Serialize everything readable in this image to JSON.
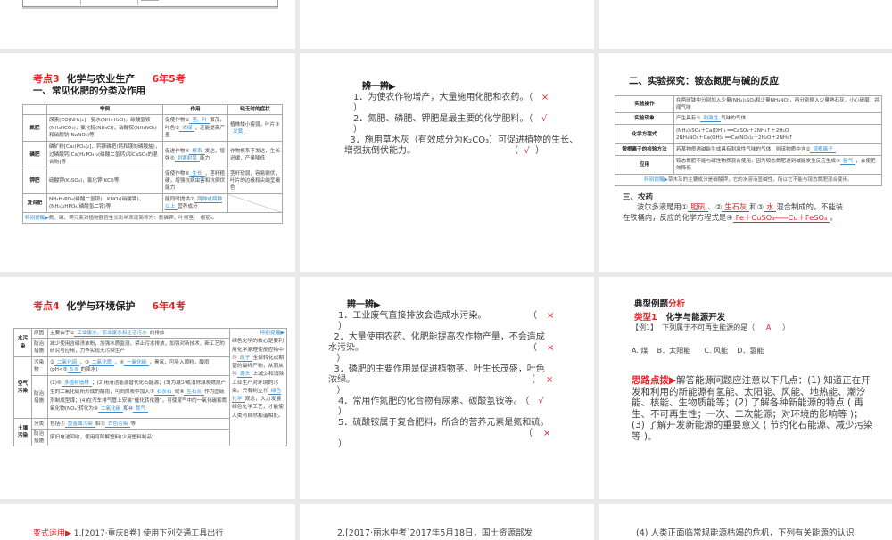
{
  "slide_top_left": {},
  "s3": {
    "title_prefix": "考点3",
    "title_main": "化学与农业生产",
    "title_freq": "6年5考",
    "subtitle": "一、常见化肥的分类及作用",
    "headers": [
      "",
      "举例",
      "作用",
      "缺乏时的症状"
    ],
    "rows": [
      {
        "type": "氮肥",
        "example": "尿素[CO(NH₂)₂]，氨水(NH₃·H₂O)，碳酸氢铵(NH₄HCO₃)，氯化铵(NH₄Cl)，硝酸铵(NH₄NO₃)和硝酸钠(NaNO₃)等",
        "effect_pre": "促使作物①",
        "fill1": "茎、叶",
        "effect_mid": "繁茂，叶色②",
        "fill2": "浓绿",
        "effect_post": "，还能提高产量",
        "symptom_pre": "植株矮小瘦弱，叶片③",
        "symptom_fill": "发黄"
      },
      {
        "type": "磷肥",
        "example": "磷矿粉[Ca₃(PO₄)₂]，钙镁磷肥(钙和镁的磷酸盐)，过磷酸钙[Ca(H₂PO₄)₂(磷酸二氢钙)和CaSO₄的混合物]等",
        "effect_pre": "促进作物④",
        "fill1": "根系",
        "effect_mid": "发达，增强⑤",
        "fill2": "耐寒耐旱",
        "effect_post": "能力",
        "symptom": "作物根系不发达，生长迟缓，产量降低"
      },
      {
        "type": "钾肥",
        "example": "硫酸钾(K₂SO₄)，氯化钾(KCl)等",
        "effect_pre": "促使作物⑥",
        "fill1": "生长",
        "effect_post": "，茎秆粗硬，增强抗病虫害和抗倒伏能力",
        "symptom": "茎秆软弱，容易倒伏，叶片的边缘和尖端呈褐色"
      },
      {
        "type": "复合肥",
        "example": "NH₄H₂PO₄(磷酸二氢铵)，KNO₃(硝酸钾)，(NH₄)₂HPO₄(磷酸氢二铵)等",
        "effect_pre": "能同时提供⑦",
        "fill1": "两种或两种以上",
        "effect_post": "营养成分"
      }
    ],
    "tip_label": "特别提醒▶",
    "tip": "氮、磷、钾元素对植物器官生长影响表现简称为：氮磷钾，叶根茎(一根筋)。"
  },
  "b1": {
    "heading": "辨一辨▶",
    "items": [
      {
        "text": "1．为使农作物增产，大量施用化肥和农药。（",
        "mark": "×",
        "close": "）"
      },
      {
        "text": "2．氮肥、磷肥、钾肥是最主要的化学肥料。（",
        "mark": "√",
        "close": "）"
      },
      {
        "text": "3．施用草木灰（有效成分为K₂CO₃）可促进植物的生长、",
        "text2": "增强抗倒伏能力。",
        "open": "（",
        "mark": "√",
        "close": "）"
      }
    ]
  },
  "exp": {
    "title": "二、实验探究：铵态氮肥与碱的反应",
    "rows": [
      {
        "label": "实验操作",
        "text": "在两研钵中分别加入少量(NH₄)₂SO₄和少量NH₄NO₃，再分别倒入少量熟石灰，小心研磨，并闻气味"
      },
      {
        "label": "实验现象",
        "pre": "产生具有①",
        "fill": "刺激性",
        "post": "气味的气体"
      },
      {
        "label": "化学方程式",
        "eq1": "(NH₄)₂SO₄＋Ca(OH)₂ ══CaSO₄＋2NH₃↑＋2H₂O",
        "eq2": "2NH₄NO₃＋Ca(OH)₂ ══Ca(NO₃)₂＋2H₂O＋2NH₃↑"
      },
      {
        "label": "铵根离子的检验方法",
        "pre": "若某物质遇碱能生成具有刺激性气味的气体，则该物质中含②",
        "fill": "铵根离子"
      },
      {
        "label": "应用",
        "pre": "铵态氮肥不能与碱性物质混合使用，因为铵态氮肥遇到碱能发生反应生成③",
        "fill": "氨气",
        "post": "，会使肥效降低"
      }
    ],
    "tip_label": "特别提醒▶",
    "tip": "草木灰的主要成分是碳酸钾，它的水溶液显碱性，所以它不能与铵态氮肥混合使用。",
    "pest_title": "三、农药",
    "pest_pre": "波尔多液是用①",
    "pest_f1": "胆矾",
    "pest_m1": "、②",
    "pest_f2": "生石灰",
    "pest_m2": "和③",
    "pest_f3": "水",
    "pest_m3": "混合制成的，不能装",
    "pest_l2": "在铁桶内，反应的化学方程式是④",
    "pest_eq": "Fe＋CuSO₄═══Cu＋FeSO₄",
    "pest_end": "。"
  },
  "s4": {
    "title_prefix": "考点4",
    "title_main": "化学与环境保护",
    "title_freq": "6年4考",
    "water": "水污染",
    "air": "空气污染",
    "soil": "土壤污染",
    "cause": "原因",
    "prevent": "防治措施",
    "pollutant": "污染物",
    "category": "分类",
    "water_cause_pre": "主要由于①",
    "water_cause_fill": "工业废水、农业废水和生活污水",
    "water_cause_post": "的排放",
    "water_prevent": "减少使用含磷洗衣粉，加强水质监测，禁止污水排放，加强对新技术、新工艺的研究与应用，力争实现无污染生产",
    "air_p": [
      "②",
      "二氧化硫",
      "，③",
      "二氧化氮",
      "，④",
      "一氧化碳",
      "，臭氧，可吸入颗粒，酸雨(pH<⑤",
      "5.6",
      "的降水)"
    ],
    "air_m": [
      "(1)⑥",
      "多植树造林",
      "；(2)用清洁能源替代化石能源；(3)为减少或消除煤炭燃烧产生的二氧化硫所形成的酸雨，可向煤炭中加入⑦",
      "石灰石",
      "或⑧",
      "生石灰",
      "作为固硫剂制成型煤；(4)在汽车排气管上安装“催化转化器”，可使尾气中的一氧化碳和氮氧化物(NOₓ)转化为⑨",
      "二氧化碳",
      "和⑩",
      "氮气"
    ],
    "soil_c": [
      "包括⑪",
      "重金属污染",
      "和⑫",
      "白色污染",
      "等"
    ],
    "soil_m": "废旧电池回收，使用可降解塑料(少用塑料制品)",
    "side_label": "特别提醒▶",
    "side": [
      "绿色化学的核心是要利用化学原理使反应物中⑬",
      "原子",
      "全部转化成期望的最终产物，从而从⑭",
      "源头",
      "上减少和消除工业生产对环境的污染。只有树立⑮",
      "绿色化学",
      "观念，大力发展绿色化学工艺，才能使人类与自然和谐相处。"
    ]
  },
  "b2": {
    "heading": "辨一辨▶",
    "items": [
      {
        "text": "1．工业废气直接排放会造成水污染。",
        "mark": "×"
      },
      {
        "text": "2．大量使用农药、化肥能提高农作物产量，不会造成",
        "text2": "水污染。",
        "mark": "×"
      },
      {
        "text": "3．磷肥的主要作用是促进植物茎、叶生长茂盛，叶色",
        "text2": "浓绿。",
        "mark": "×"
      },
      {
        "text": "4．常用作氮肥的化合物有尿素、碳酸氢铵等。",
        "mark": "√"
      },
      {
        "text": "5．硫酸铵属于复合肥料，所含的营养元素是氮和硫。",
        "mark": "×"
      }
    ],
    "open": "（",
    "close": "）"
  },
  "ex": {
    "head_a": "典型例题",
    "head_b": "分析",
    "type_label": "类型1",
    "type_title": "化学与能源开发",
    "q_label": "【例1】",
    "q_text": "下列属于不可再生能源的是（",
    "q_answer": "A",
    "q_close": "）",
    "options": [
      "A. 煤",
      "B．太阳能",
      "C. 风能",
      "D．氢能"
    ],
    "hint_label": "思路点拨▶",
    "hint": "解答能源问题应注意以下几点：(1) 知道正在开发和利用的新能源有氢能、太阳能、风能、地热能、潮汐能、核能、生物质能等；(2) 了解各种新能源的特点 ( 再生、不可再生性；一次、二次能源；对环境的影响等 )；(3) 了解开发新能源的重要意义 ( 节约化石能源、减少污染等 )。"
  },
  "bottom": {
    "left_label": "变式运用▶",
    "left": "1.[2017·重庆B卷] 使用下列交通工具出行",
    "mid": "2.[2017·丽水中考]2017年5月18日，国土资源部发",
    "right": "(4) 人类正面临常规能源枯竭的危机，下列有关能源的认识"
  }
}
